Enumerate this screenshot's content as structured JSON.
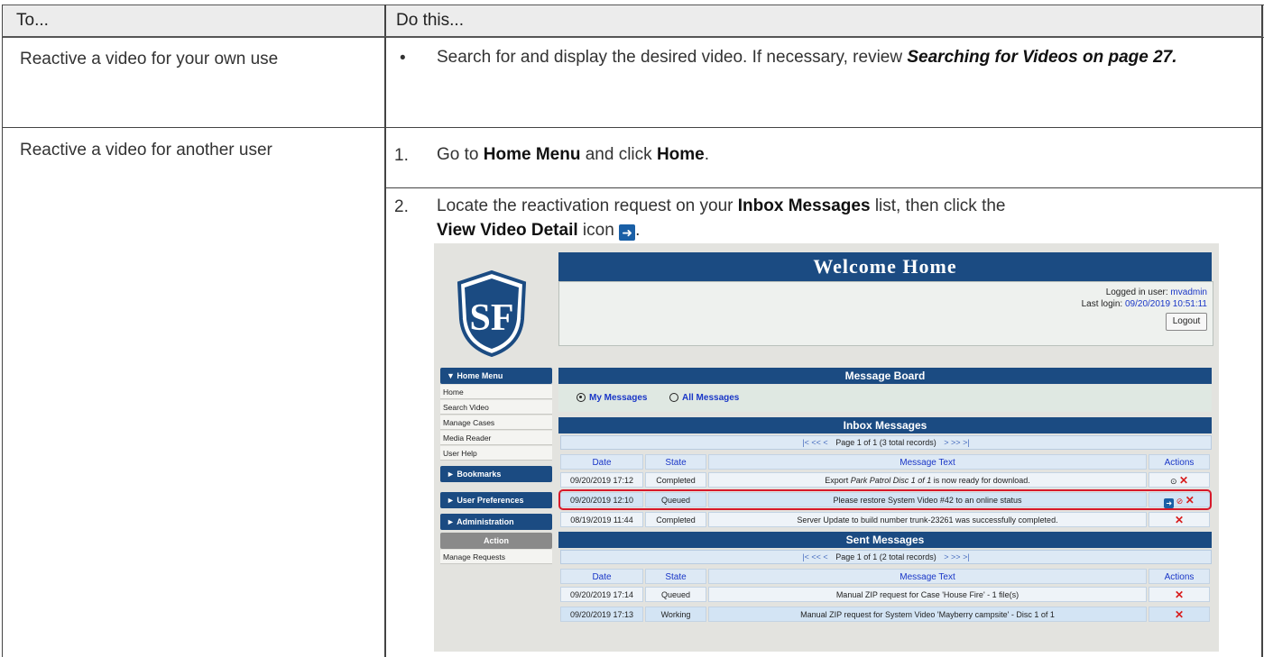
{
  "table": {
    "col1_header": "To...",
    "col2_header": "Do this...",
    "row1": {
      "to": "Reactive a video for your own use",
      "bullet": "•",
      "text_a": "Search for and display the desired video. If necessary, review",
      "link": "Searching for Videos on page 27."
    },
    "row2": {
      "to": "Reactive a video for another user",
      "step1_num": "1.",
      "step1_a": "Go to",
      "step1_b": "Home Menu",
      "step1_c": "and click",
      "step1_d": "Home",
      "step1_e": ".",
      "step2_num": "2.",
      "step2_a": "Locate the reactivation request on your",
      "step2_b": "Inbox Messages",
      "step2_c": "list, then click the",
      "step2_d": "View Video Detail",
      "step2_e": "icon",
      "step2_f": "."
    }
  },
  "app": {
    "logo_text": "SF",
    "welcome": "Welcome Home",
    "logged_in_label": "Logged in user:",
    "logged_in_user": "mvadmin",
    "last_login_label": "Last login:",
    "last_login_value": "09/20/2019 10:51:11",
    "logout": "Logout",
    "menu": {
      "home_menu": "▼ Home Menu",
      "items": [
        "Home",
        "Search Video",
        "Manage Cases",
        "Media Reader",
        "User Help"
      ],
      "bookmarks": "► Bookmarks",
      "user_prefs": "► User Preferences",
      "administration": "► Administration",
      "action": "Action",
      "manage_requests": "Manage Requests"
    },
    "message_board": "Message Board",
    "my_messages": "My Messages",
    "all_messages": "All Messages",
    "inbox": {
      "title": "Inbox Messages",
      "pager": "Page 1 of 1 (3 total records)",
      "headers": [
        "Date",
        "State",
        "Message Text",
        "Actions"
      ],
      "rows": [
        {
          "date": "09/20/2019 17:12",
          "state": "Completed",
          "text_a": "Export ",
          "text_i": "Park Patrol Disc 1 of 1",
          "text_b": " is now ready for download."
        },
        {
          "date": "09/20/2019 12:10",
          "state": "Queued",
          "text_a": "Please restore System Video #42 to an online status",
          "text_i": "",
          "text_b": ""
        },
        {
          "date": "08/19/2019 11:44",
          "state": "Completed",
          "text_a": "Server Update to build number trunk-23261 was successfully completed.",
          "text_i": "",
          "text_b": ""
        }
      ]
    },
    "sent": {
      "title": "Sent Messages",
      "pager": "Page 1 of 1 (2 total records)",
      "headers": [
        "Date",
        "State",
        "Message Text",
        "Actions"
      ],
      "rows": [
        {
          "date": "09/20/2019 17:14",
          "state": "Queued",
          "text": "Manual ZIP request for Case 'House Fire' - 1 file(s)"
        },
        {
          "date": "09/20/2019 17:13",
          "state": "Working",
          "text": "Manual ZIP request for System Video 'Mayberry campsite' - Disc 1 of 1"
        }
      ]
    }
  }
}
